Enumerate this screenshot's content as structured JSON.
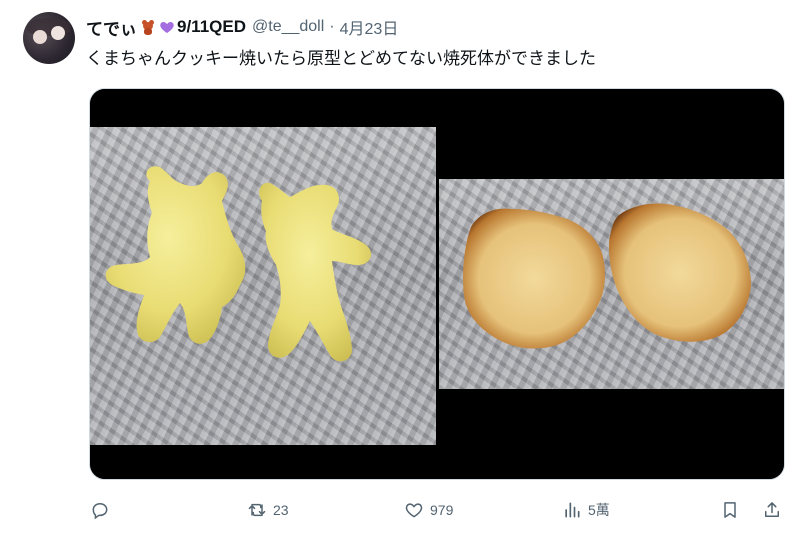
{
  "tweet": {
    "display_name": "てでぃ",
    "display_name_suffix": "9/11QED",
    "handle": "@te__doll",
    "separator": "·",
    "date": "4月23日",
    "text": "くまちゃんクッキー焼いたら原型とどめてない焼死体ができました"
  },
  "actions": {
    "reply_count": "",
    "retweet_count": "23",
    "like_count": "979",
    "views_count": "5萬"
  },
  "icons": {
    "avatar": "avatar-photo",
    "name_emoji_1": "teddy-bear-emoji",
    "name_emoji_2": "purple-heart-emoji",
    "reply": "reply-icon",
    "retweet": "retweet-icon",
    "like": "heart-icon",
    "views": "views-chart-icon",
    "bookmark": "bookmark-icon",
    "share": "share-icon"
  },
  "colors": {
    "text_primary": "#0f1419",
    "text_secondary": "#536471",
    "heart_emoji": "#a56ee0",
    "bear_emoji": "#c7522a"
  }
}
